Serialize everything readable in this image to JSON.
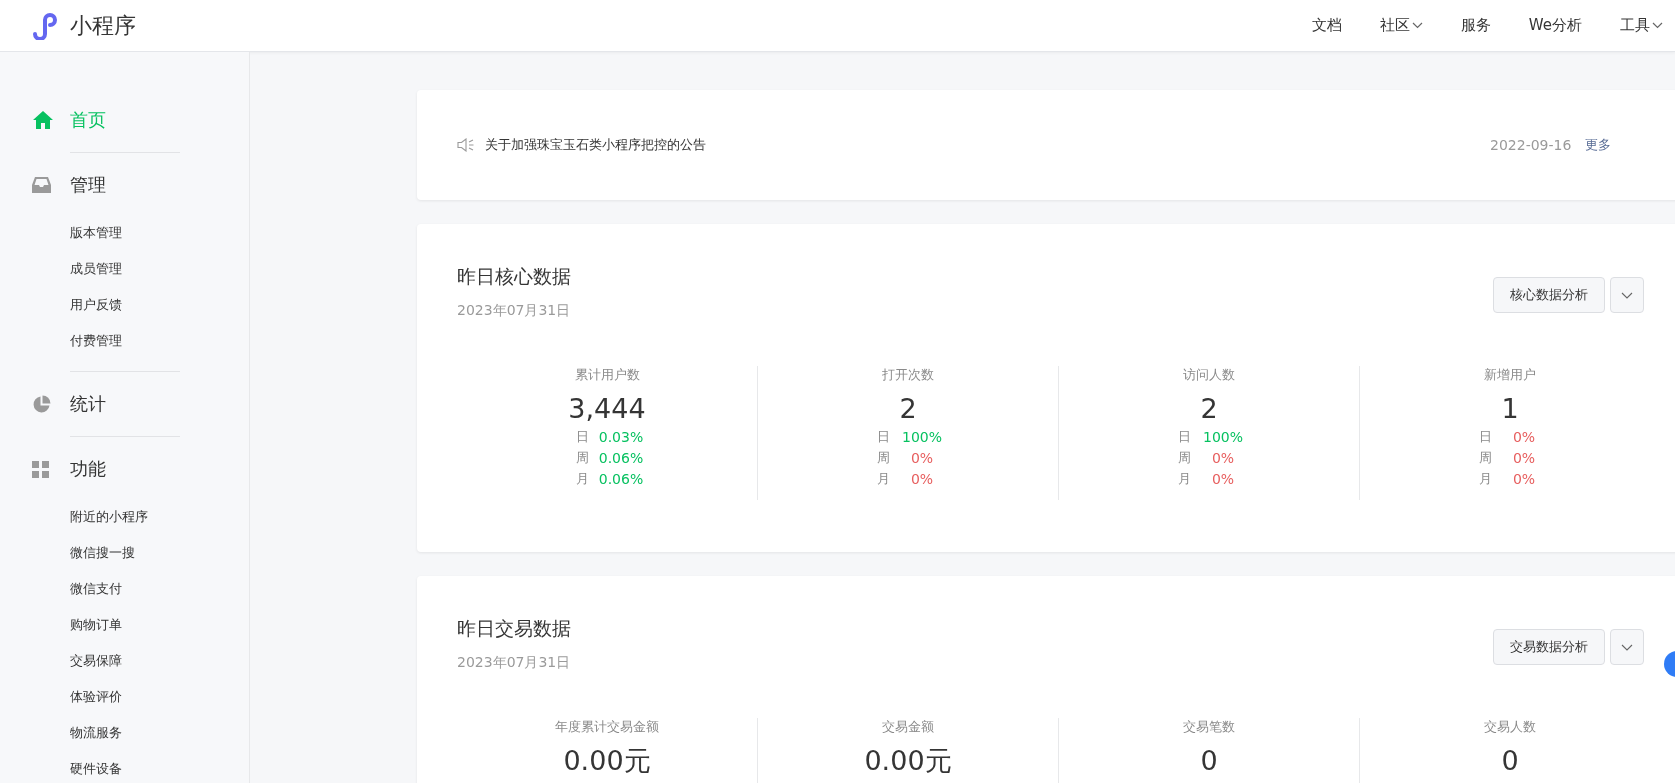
{
  "header": {
    "logo_text": "小程序",
    "nav": [
      {
        "label": "文档",
        "dropdown": false
      },
      {
        "label": "社区",
        "dropdown": true
      },
      {
        "label": "服务",
        "dropdown": false
      },
      {
        "label": "We分析",
        "dropdown": false
      },
      {
        "label": "工具",
        "dropdown": true
      }
    ]
  },
  "sidebar": {
    "sections": [
      {
        "label": "首页",
        "selected": true
      },
      {
        "label": "管理",
        "selected": false,
        "items": [
          "版本管理",
          "成员管理",
          "用户反馈",
          "付费管理"
        ]
      },
      {
        "label": "统计",
        "selected": false
      },
      {
        "label": "功能",
        "selected": false,
        "items": [
          "附近的小程序",
          "微信搜一搜",
          "微信支付",
          "购物订单",
          "交易保障",
          "体验评价",
          "物流服务",
          "硬件设备"
        ]
      }
    ]
  },
  "notice": {
    "text": "关于加强珠宝玉石类小程序把控的公告",
    "date": "2022-09-16",
    "more": "更多"
  },
  "panels": [
    {
      "title": "昨日核心数据",
      "date": "2023年07月31日",
      "button": "核心数据分析",
      "stats": [
        {
          "label": "累计用户数",
          "value": "3,444",
          "changes": [
            {
              "period": "日",
              "value": "0.03%",
              "color": "#07c160"
            },
            {
              "period": "周",
              "value": "0.06%",
              "color": "#07c160"
            },
            {
              "period": "月",
              "value": "0.06%",
              "color": "#07c160"
            }
          ]
        },
        {
          "label": "打开次数",
          "value": "2",
          "changes": [
            {
              "period": "日",
              "value": "100%",
              "color": "#07c160"
            },
            {
              "period": "周",
              "value": "0%",
              "color": "#e75e5e"
            },
            {
              "period": "月",
              "value": "0%",
              "color": "#e75e5e"
            }
          ]
        },
        {
          "label": "访问人数",
          "value": "2",
          "changes": [
            {
              "period": "日",
              "value": "100%",
              "color": "#07c160"
            },
            {
              "period": "周",
              "value": "0%",
              "color": "#e75e5e"
            },
            {
              "period": "月",
              "value": "0%",
              "color": "#e75e5e"
            }
          ]
        },
        {
          "label": "新增用户",
          "value": "1",
          "changes": [
            {
              "period": "日",
              "value": "0%",
              "color": "#e75e5e"
            },
            {
              "period": "周",
              "value": "0%",
              "color": "#e75e5e"
            },
            {
              "period": "月",
              "value": "0%",
              "color": "#e75e5e"
            }
          ]
        }
      ]
    },
    {
      "title": "昨日交易数据",
      "date": "2023年07月31日",
      "button": "交易数据分析",
      "stats": [
        {
          "label": "年度累计交易金额",
          "value": "0.00元"
        },
        {
          "label": "交易金额",
          "value": "0.00元"
        },
        {
          "label": "交易笔数",
          "value": "0"
        },
        {
          "label": "交易人数",
          "value": "0"
        }
      ]
    }
  ]
}
